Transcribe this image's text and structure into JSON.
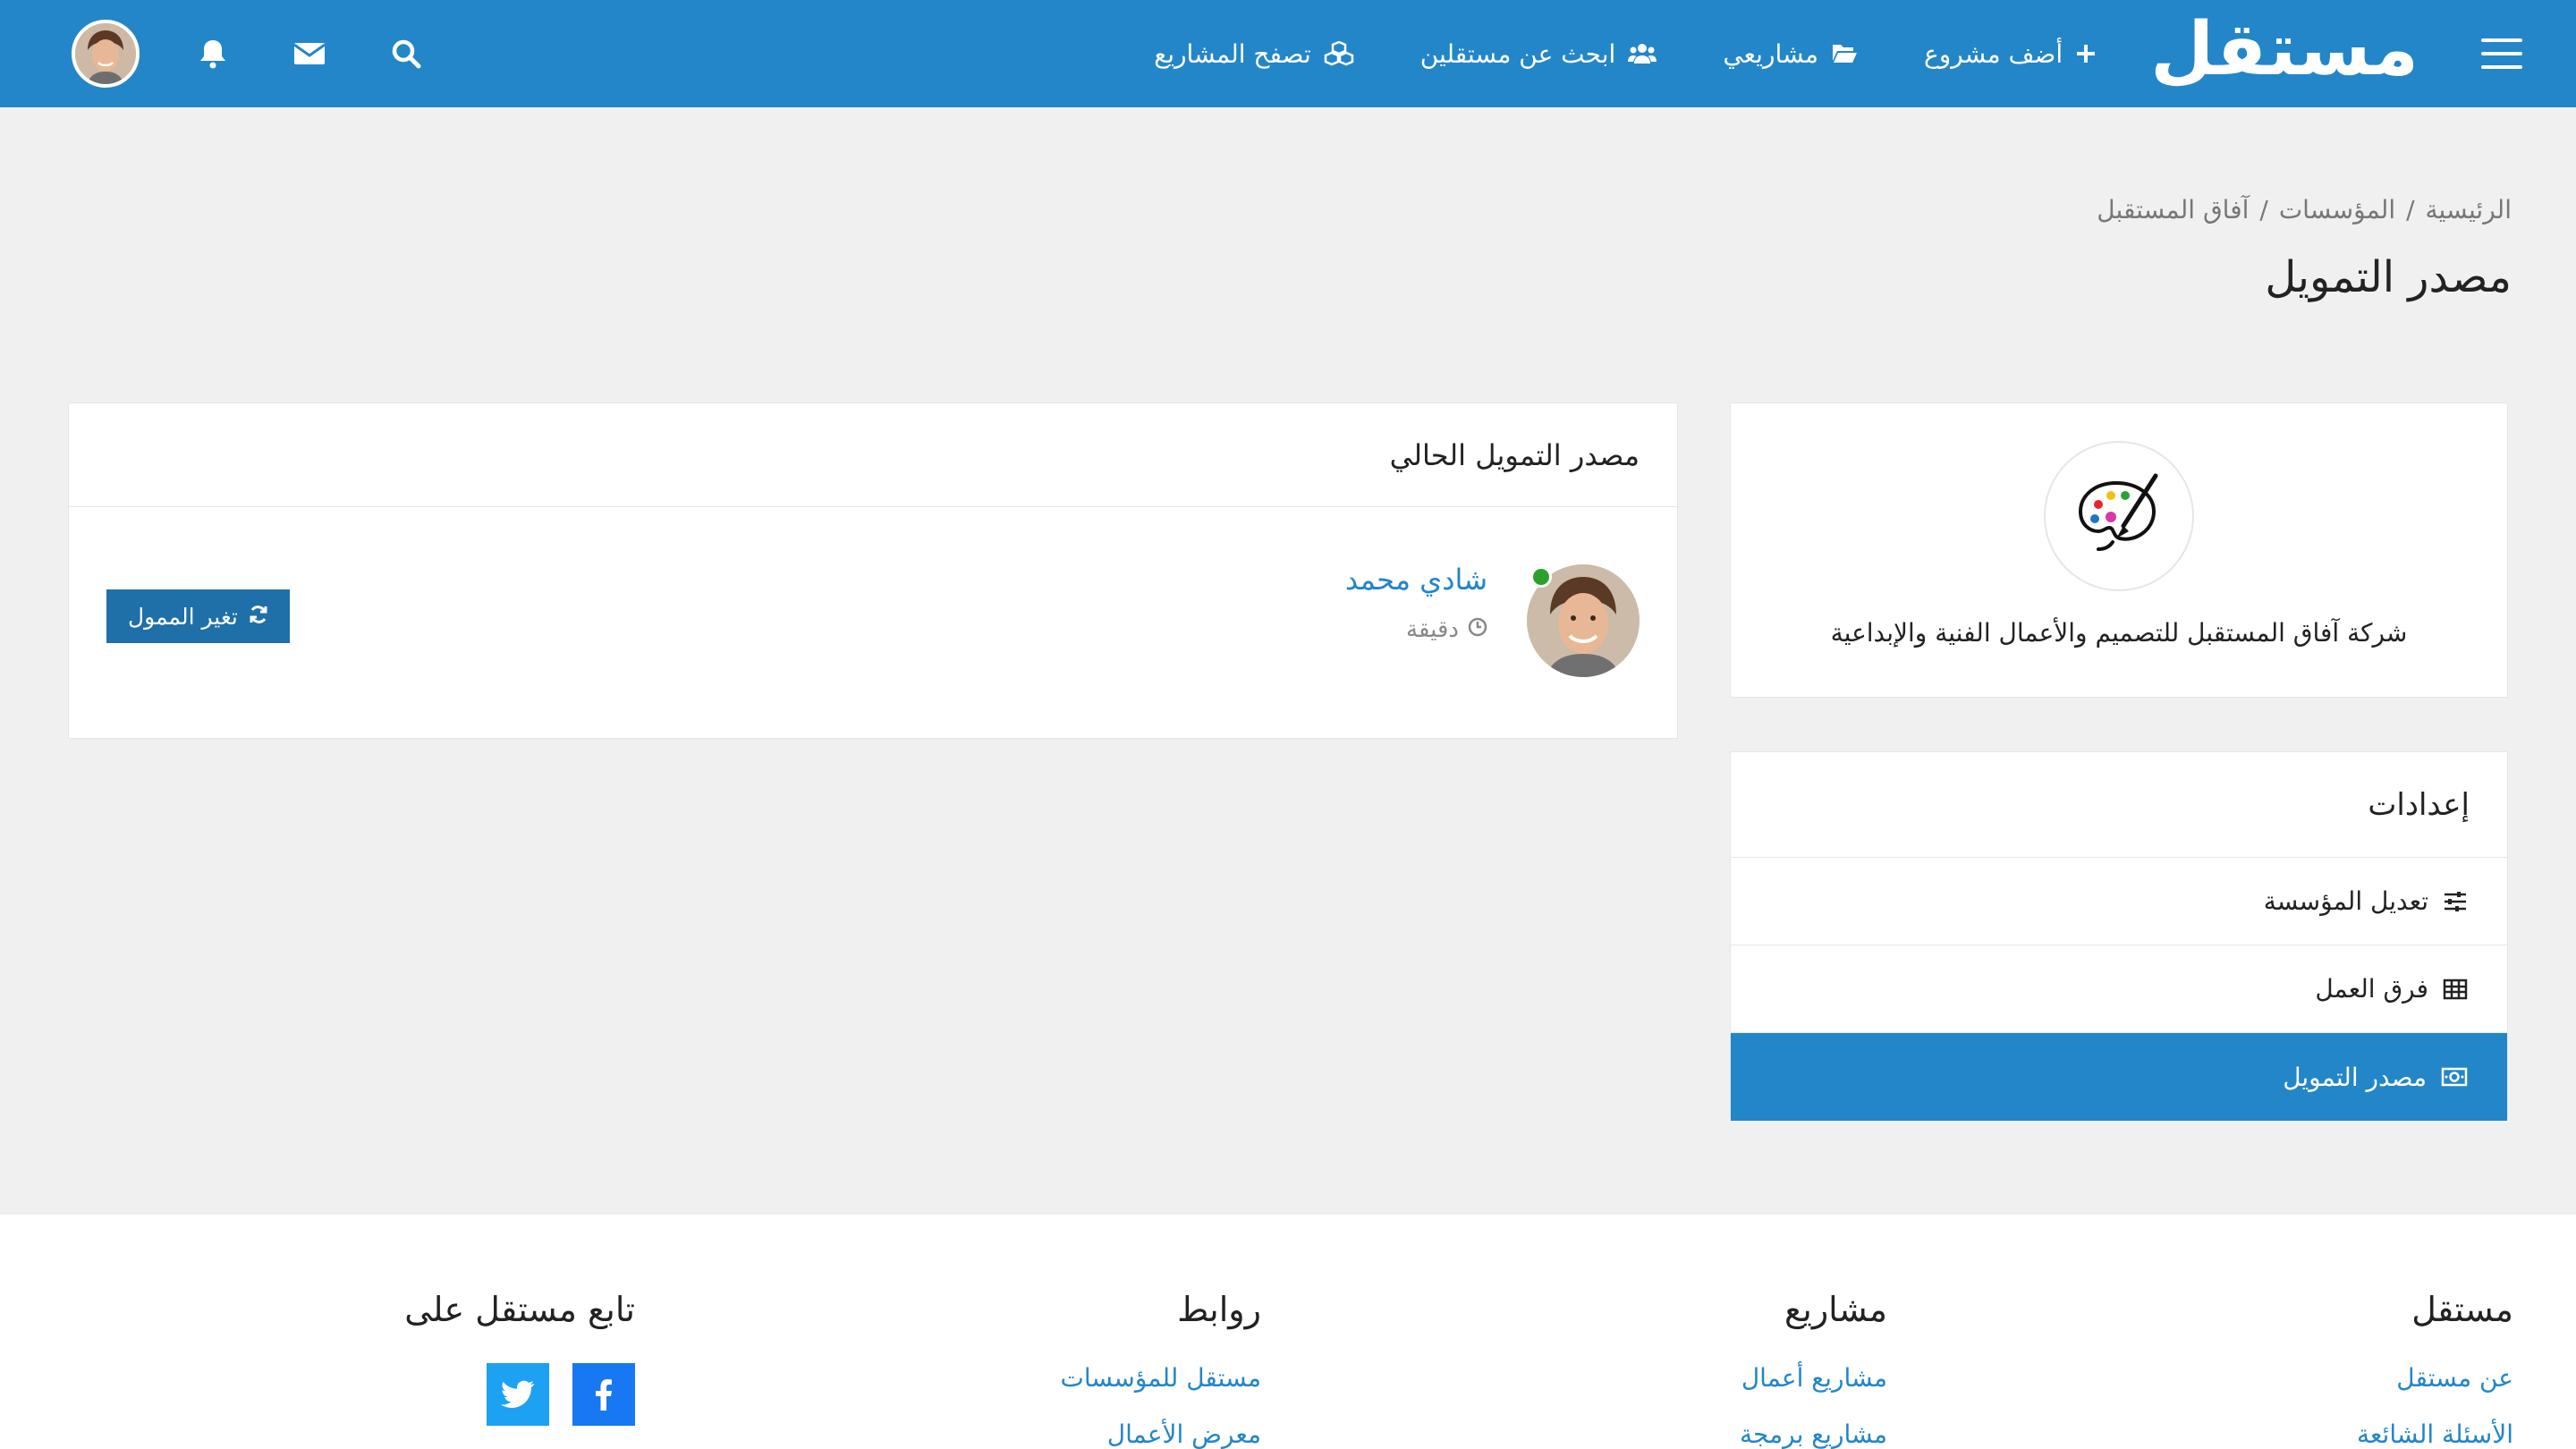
{
  "nav": {
    "logo": "مستقل",
    "add_project": "أضف مشروع",
    "my_projects": "مشاريعي",
    "find_freelancers": "ابحث عن مستقلين",
    "browse_projects": "تصفح المشاريع"
  },
  "breadcrumb": {
    "home": "الرئيسية",
    "orgs": "المؤسسات",
    "current": "آفاق المستقبل",
    "separator": "/"
  },
  "page": {
    "title": "مصدر التمويل"
  },
  "org": {
    "name": "شركة آفاق المستقبل للتصميم والأعمال الفنية والإبداعية"
  },
  "settings": {
    "title": "إعدادات",
    "items": [
      {
        "label": "تعديل المؤسسة",
        "icon": "sliders-icon"
      },
      {
        "label": "فرق العمل",
        "icon": "table-icon"
      },
      {
        "label": "مصدر التمويل",
        "icon": "money-icon"
      }
    ]
  },
  "funding": {
    "header": "مصدر التمويل الحالي",
    "funder_name": "شادي محمد",
    "time": "دقيقة",
    "change_button": "تغير الممول"
  },
  "footer": {
    "col1": {
      "title": "مستقل",
      "links": [
        "عن مستقل",
        "الأسئلة الشائعة"
      ]
    },
    "col2": {
      "title": "مشاريع",
      "links": [
        "مشاريع أعمال",
        "مشاريع برمجة"
      ]
    },
    "col3": {
      "title": "روابط",
      "links": [
        "مستقل للمؤسسات",
        "معرض الأعمال"
      ]
    },
    "col4": {
      "title": "تابع مستقل على"
    }
  },
  "colors": {
    "brand": "#2386c8",
    "online": "#2ca02c"
  }
}
